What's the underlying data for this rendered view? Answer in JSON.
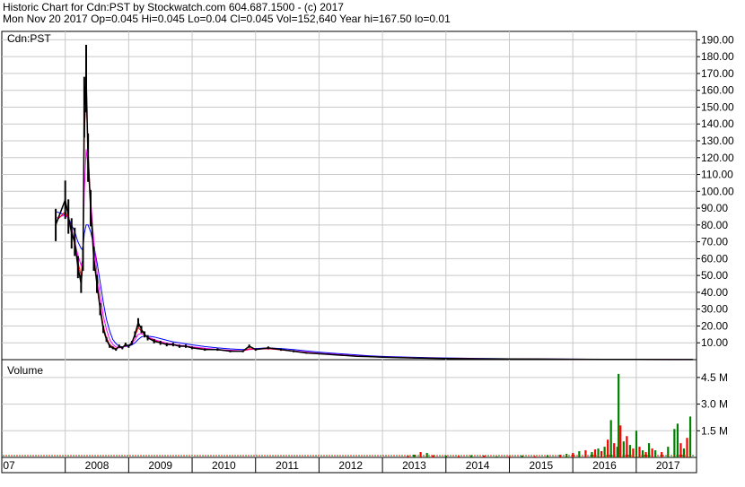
{
  "header": {
    "line1": "Historic Chart for Cdn:PST by Stockwatch.com 604.687.1500 - (c) 2017",
    "line2": "Mon Nov 20 2017   Op=0.045   Hi=0.045   Lo=0.04   Cl=0.045   Vol=152,640   Year hi=167.50   lo=0.01"
  },
  "chart_data": [
    {
      "type": "line",
      "title": "Cdn:PST",
      "x_tick_labels": [
        "07",
        "2008",
        "2009",
        "2010",
        "2011",
        "2012",
        "2013",
        "2014",
        "2015",
        "2016",
        "2017"
      ],
      "y_tick_labels": [
        "10.00",
        "20.00",
        "30.00",
        "40.00",
        "50.00",
        "60.00",
        "70.00",
        "80.00",
        "90.00",
        "100.00",
        "110.00",
        "120.00",
        "130.00",
        "140.00",
        "150.00",
        "160.00",
        "170.00",
        "180.00",
        "190.00"
      ],
      "ylim": [
        0,
        195
      ],
      "grid": true,
      "x_years": [
        2007.85,
        2008.0,
        2008.05,
        2008.1,
        2008.15,
        2008.2,
        2008.25,
        2008.28,
        2008.3,
        2008.33,
        2008.36,
        2008.4,
        2008.45,
        2008.5,
        2008.55,
        2008.6,
        2008.65,
        2008.7,
        2008.75,
        2008.8,
        2008.85,
        2008.9,
        2008.95,
        2009.0,
        2009.05,
        2009.1,
        2009.15,
        2009.2,
        2009.25,
        2009.3,
        2009.4,
        2009.5,
        2009.6,
        2009.7,
        2009.8,
        2009.9,
        2010.0,
        2010.2,
        2010.4,
        2010.6,
        2010.8,
        2010.9,
        2011.0,
        2011.2,
        2011.4,
        2011.6,
        2011.8,
        2012.0,
        2012.2,
        2012.4,
        2012.6,
        2012.8,
        2013.0,
        2013.5,
        2014.0,
        2014.5,
        2015.0,
        2015.5,
        2016.0,
        2016.5,
        2017.0,
        2017.5,
        2017.89
      ],
      "series": [
        {
          "color": "#000000",
          "values": [
            80,
            95,
            85,
            75,
            70,
            55,
            45,
            60,
            150,
            167,
            120,
            90,
            60,
            45,
            30,
            18,
            12,
            8,
            7,
            6,
            8,
            7,
            9,
            8,
            10,
            15,
            22,
            18,
            15,
            13,
            11,
            10,
            9,
            9,
            8,
            8,
            7,
            6,
            6,
            5,
            5,
            8,
            6,
            7,
            6,
            5,
            4,
            3.5,
            3,
            2.5,
            2,
            1.8,
            1.5,
            1,
            0.7,
            0.5,
            0.4,
            0.3,
            0.2,
            0.15,
            0.1,
            0.06,
            0.045
          ]
        },
        {
          "color": "#ff0000",
          "values": [
            82,
            88,
            84,
            76,
            68,
            58,
            50,
            62,
            135,
            155,
            125,
            92,
            62,
            46,
            32,
            20,
            13,
            9,
            7.5,
            6.5,
            7.5,
            7.2,
            8.5,
            8.5,
            10,
            14,
            19,
            17,
            15,
            13,
            11.5,
            10.2,
            9.2,
            8.8,
            8.2,
            7.8,
            7.2,
            6.3,
            5.8,
            5.2,
            5,
            6.5,
            6.2,
            6.5,
            5.8,
            5,
            4.2,
            3.6,
            3.1,
            2.6,
            2.1,
            1.8,
            1.5,
            1.05,
            0.75,
            0.55,
            0.42,
            0.32,
            0.22,
            0.16,
            0.11,
            0.07,
            0.05
          ]
        },
        {
          "color": "#ff00ff",
          "values": [
            84,
            86,
            84,
            78,
            70,
            62,
            56,
            60,
            100,
            125,
            115,
            95,
            70,
            52,
            38,
            26,
            18,
            12,
            9,
            7.5,
            7,
            7.2,
            8,
            8.3,
            9.5,
            12,
            15,
            15.5,
            14.5,
            13.5,
            12,
            10.8,
            9.8,
            9.2,
            8.6,
            8.2,
            7.6,
            6.8,
            6.1,
            5.6,
            5.3,
            6,
            6.3,
            6.4,
            6,
            5.3,
            4.5,
            3.8,
            3.3,
            2.8,
            2.3,
            1.9,
            1.6,
            1.1,
            0.8,
            0.6,
            0.45,
            0.34,
            0.24,
            0.18,
            0.12,
            0.08,
            0.06
          ]
        },
        {
          "color": "#0000ff",
          "values": [
            88,
            86,
            84,
            80,
            76,
            70,
            66,
            65,
            75,
            80,
            80,
            76,
            68,
            58,
            46,
            34,
            24,
            17,
            12,
            9.5,
            8,
            7.6,
            7.8,
            8,
            8.8,
            10,
            12,
            13.5,
            14,
            14,
            13.5,
            12.5,
            11.5,
            10.6,
            10,
            9.4,
            8.8,
            7.8,
            7,
            6.4,
            6,
            6.2,
            6.6,
            7,
            6.6,
            6,
            5.2,
            4.5,
            3.9,
            3.3,
            2.8,
            2.3,
            1.9,
            1.4,
            1,
            0.75,
            0.55,
            0.42,
            0.3,
            0.22,
            0.15,
            0.1,
            0.07
          ]
        }
      ]
    },
    {
      "type": "bar",
      "title": "Volume",
      "y_tick_labels": [
        "1.5 M",
        "3.0 M",
        "4.5 M"
      ],
      "ylim": [
        0,
        5.3
      ],
      "unit": "M",
      "x_years": [
        2013.4,
        2013.5,
        2013.6,
        2013.7,
        2013.8,
        2014.0,
        2014.2,
        2014.4,
        2014.6,
        2014.8,
        2015.0,
        2015.2,
        2015.4,
        2015.6,
        2015.8,
        2015.9,
        2016.0,
        2016.1,
        2016.2,
        2016.3,
        2016.35,
        2016.4,
        2016.45,
        2016.5,
        2016.55,
        2016.6,
        2016.65,
        2016.7,
        2016.72,
        2016.75,
        2016.8,
        2016.85,
        2016.9,
        2016.95,
        2017.0,
        2017.05,
        2017.1,
        2017.15,
        2017.2,
        2017.25,
        2017.3,
        2017.4,
        2017.5,
        2017.6,
        2017.65,
        2017.7,
        2017.75,
        2017.8,
        2017.85
      ],
      "values": [
        0.1,
        0.15,
        0.3,
        0.25,
        0.12,
        0.1,
        0.08,
        0.12,
        0.1,
        0.06,
        0.08,
        0.1,
        0.07,
        0.12,
        0.15,
        0.2,
        0.25,
        0.35,
        0.4,
        0.3,
        0.45,
        0.5,
        0.35,
        0.6,
        1.0,
        2.1,
        0.8,
        0.6,
        4.7,
        1.8,
        0.9,
        1.2,
        0.7,
        0.5,
        1.5,
        0.6,
        0.4,
        0.3,
        0.8,
        0.5,
        0.4,
        0.3,
        0.6,
        1.6,
        1.9,
        0.8,
        0.5,
        1.1,
        2.3
      ],
      "colors": [
        "#ff0000",
        "#008000",
        "#ff0000",
        "#008000",
        "#ff0000",
        "#008000",
        "#ff0000",
        "#008000",
        "#ff0000",
        "#008000",
        "#ff0000",
        "#008000",
        "#ff0000",
        "#008000",
        "#ff0000",
        "#008000",
        "#ff0000",
        "#008000",
        "#ff0000",
        "#008000",
        "#ff0000",
        "#008000",
        "#ff0000",
        "#008000",
        "#ff0000",
        "#008000",
        "#ff0000",
        "#008000",
        "#008000",
        "#ff0000",
        "#008000",
        "#ff0000",
        "#008000",
        "#ff0000",
        "#008000",
        "#ff0000",
        "#008000",
        "#ff0000",
        "#008000",
        "#ff0000",
        "#008000",
        "#ff0000",
        "#008000",
        "#008000",
        "#008000",
        "#ff0000",
        "#008000",
        "#ff0000",
        "#008000"
      ]
    }
  ]
}
